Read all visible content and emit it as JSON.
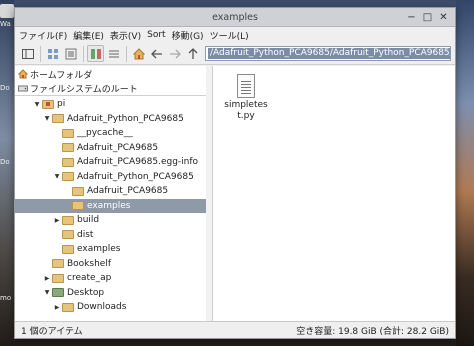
{
  "window": {
    "title": "examples"
  },
  "menu": [
    "ファイル(F)",
    "編集(E)",
    "表示(V)",
    "Sort",
    "移動(G)",
    "ツール(L)"
  ],
  "path": "/Adafruit_Python_PCA9685/Adafruit_Python_PCA9685/examples",
  "places": [
    {
      "label": "ホームフォルダ",
      "icon": "home-icon"
    },
    {
      "label": "ファイルシステムのルート",
      "icon": "drive-icon"
    }
  ],
  "tree": [
    {
      "label": "pi",
      "depth": 0,
      "arrow": "down",
      "icon": "home-folder"
    },
    {
      "label": "Adafruit_Python_PCA9685",
      "depth": 1,
      "arrow": "down"
    },
    {
      "label": "__pycache__",
      "depth": 2,
      "arrow": ""
    },
    {
      "label": "Adafruit_PCA9685",
      "depth": 2,
      "arrow": ""
    },
    {
      "label": "Adafruit_PCA9685.egg-info",
      "depth": 2,
      "arrow": ""
    },
    {
      "label": "Adafruit_Python_PCA9685",
      "depth": 2,
      "arrow": "down"
    },
    {
      "label": "Adafruit_PCA9685",
      "depth": 3,
      "arrow": ""
    },
    {
      "label": "examples",
      "depth": 3,
      "arrow": "",
      "selected": true
    },
    {
      "label": "build",
      "depth": 2,
      "arrow": "right"
    },
    {
      "label": "dist",
      "depth": 2,
      "arrow": ""
    },
    {
      "label": "examples",
      "depth": 2,
      "arrow": ""
    },
    {
      "label": "Bookshelf",
      "depth": 1,
      "arrow": ""
    },
    {
      "label": "create_ap",
      "depth": 1,
      "arrow": "right"
    },
    {
      "label": "Desktop",
      "depth": 1,
      "arrow": "down",
      "icon": "desktop-folder"
    },
    {
      "label": "Downloads",
      "depth": 2,
      "arrow": "right"
    }
  ],
  "files": [
    {
      "name": "simpletest.py",
      "icon": "text-file-icon"
    }
  ],
  "status": {
    "left": "1 個のアイテム",
    "right": "空き容量: 19.8 GiB (合計: 28.2 GiB)"
  },
  "desktop_labels": [
    "Wa",
    "Do",
    "Do",
    "mo"
  ],
  "colors": {
    "selection": "#8f9aa9",
    "path_highlight": "#7b8da6"
  }
}
